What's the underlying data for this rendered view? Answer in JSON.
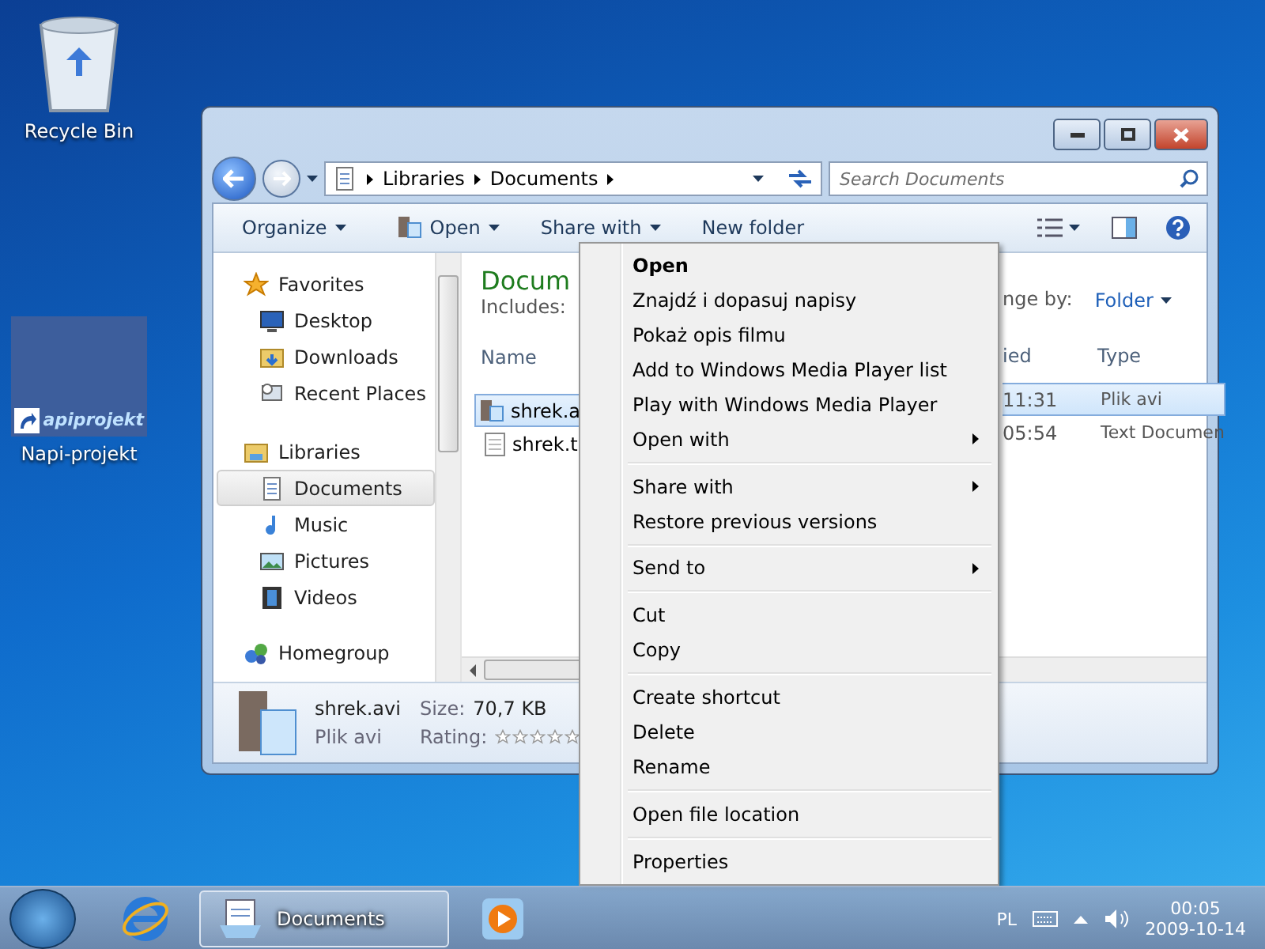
{
  "desktop_icons": [
    {
      "kind": "recycle",
      "label": "Recycle Bin"
    },
    {
      "kind": "napi",
      "label": "Napi-projekt",
      "logo_text": "apiprojekt"
    }
  ],
  "explorer": {
    "breadcrumb": [
      "Libraries",
      "Documents"
    ],
    "search": {
      "placeholder": "Search Documents"
    },
    "toolbar": [
      {
        "label": "Organize",
        "dropdown": true,
        "kind": "plain"
      },
      {
        "label": "Open",
        "dropdown": true,
        "kind": "open"
      },
      {
        "label": "Share with",
        "dropdown": true,
        "kind": "plain"
      },
      {
        "label": "New folder",
        "dropdown": false,
        "kind": "plain"
      }
    ],
    "navigation": [
      {
        "label": "Favorites",
        "kind": "star",
        "children": [
          {
            "label": "Desktop",
            "kind": "desktop",
            "selected": false
          },
          {
            "label": "Downloads",
            "kind": "downloads",
            "selected": false
          },
          {
            "label": "Recent Places",
            "kind": "recent",
            "selected": false
          }
        ]
      },
      {
        "label": "Libraries",
        "kind": "library",
        "children": [
          {
            "label": "Documents",
            "kind": "document",
            "selected": true
          },
          {
            "label": "Music",
            "kind": "music",
            "selected": false
          },
          {
            "label": "Pictures",
            "kind": "pictures",
            "selected": false
          },
          {
            "label": "Videos",
            "kind": "videos",
            "selected": false
          }
        ]
      },
      {
        "label": "Homegroup",
        "kind": "homegroup"
      }
    ],
    "content": {
      "title": "Docum",
      "includes": "Includes:",
      "arrange_label": "nge by:",
      "arrange_value": "Folder",
      "columns": [
        "Name",
        "ied",
        "Type"
      ],
      "rows": [
        {
          "kind": "video",
          "name": "shrek.a",
          "time": "11:31",
          "type": "Plik avi",
          "selected": true
        },
        {
          "kind": "text",
          "name": "shrek.t",
          "time": "05:54",
          "type": "Text Documen",
          "selected": false
        }
      ]
    },
    "details": {
      "name": "shrek.avi",
      "type": "Plik avi",
      "size_label": "Size:",
      "size": "70,7 KB",
      "rating_label": "Rating:",
      "stars": 0
    }
  },
  "context_menu": [
    {
      "kind": "item",
      "label": "Open",
      "default": true,
      "submenu": false
    },
    {
      "kind": "item",
      "label": "Znajdź i dopasuj napisy",
      "default": false,
      "submenu": false
    },
    {
      "kind": "item",
      "label": "Pokaż opis filmu",
      "default": false,
      "submenu": false
    },
    {
      "kind": "item",
      "label": "Add to Windows Media Player list",
      "default": false,
      "submenu": false
    },
    {
      "kind": "item",
      "label": "Play with Windows Media Player",
      "default": false,
      "submenu": false
    },
    {
      "kind": "item",
      "label": "Open with",
      "default": false,
      "submenu": true
    },
    {
      "kind": "separator"
    },
    {
      "kind": "item",
      "label": "Share with",
      "default": false,
      "submenu": true
    },
    {
      "kind": "item",
      "label": "Restore previous versions",
      "default": false,
      "submenu": false
    },
    {
      "kind": "separator"
    },
    {
      "kind": "item",
      "label": "Send to",
      "default": false,
      "submenu": true
    },
    {
      "kind": "separator"
    },
    {
      "kind": "item",
      "label": "Cut",
      "default": false,
      "submenu": false
    },
    {
      "kind": "item",
      "label": "Copy",
      "default": false,
      "submenu": false
    },
    {
      "kind": "separator"
    },
    {
      "kind": "item",
      "label": "Create shortcut",
      "default": false,
      "submenu": false
    },
    {
      "kind": "item",
      "label": "Delete",
      "default": false,
      "submenu": false
    },
    {
      "kind": "item",
      "label": "Rename",
      "default": false,
      "submenu": false
    },
    {
      "kind": "separator"
    },
    {
      "kind": "item",
      "label": "Open file location",
      "default": false,
      "submenu": false
    },
    {
      "kind": "separator"
    },
    {
      "kind": "item",
      "label": "Properties",
      "default": false,
      "submenu": false
    }
  ],
  "taskbar": {
    "tasks": [
      {
        "kind": "ie",
        "selected": false
      },
      {
        "kind": "explorer",
        "label": "Documents",
        "selected": true
      },
      {
        "kind": "mediaplayer",
        "selected": false
      }
    ],
    "language": "PL",
    "time": "00:05",
    "date": "2009-10-14"
  }
}
